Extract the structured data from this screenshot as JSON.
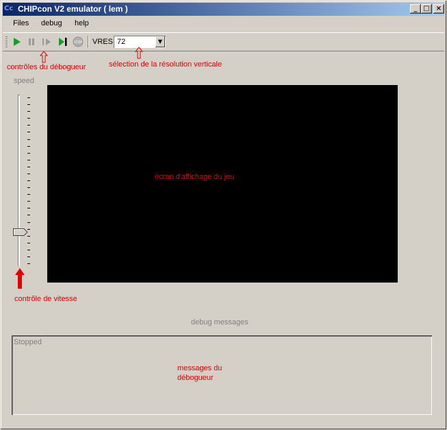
{
  "window": {
    "title": "CHIPcon V2 emulator ( lem )",
    "icon_glyph": "Cc",
    "controls": {
      "minimize": "_",
      "maximize": "□",
      "close": "×"
    }
  },
  "menu": {
    "items": [
      {
        "label": "Files"
      },
      {
        "label": "debug"
      },
      {
        "label": "help"
      }
    ]
  },
  "toolbar": {
    "buttons": [
      {
        "name": "run",
        "icon": "play-icon"
      },
      {
        "name": "pause",
        "icon": "pause-icon"
      },
      {
        "name": "step",
        "icon": "step-icon"
      },
      {
        "name": "step-over",
        "icon": "step-over-icon"
      },
      {
        "name": "stop",
        "icon": "stop-icon",
        "label": "STOP"
      }
    ],
    "vres_label": "VRES",
    "vres_value": "72"
  },
  "annotations": {
    "debugger_controls": "contrôles du débogueur",
    "vres_selection": "sélection de la résolution verticale",
    "speed_control": "contrôle de vitesse",
    "game_screen": "écran d'affichage du jeu",
    "debug_messages_note": "messages du débogueur"
  },
  "speed": {
    "label": "speed",
    "level": 0.2
  },
  "debug": {
    "label": "debug messages",
    "status": "Stopped"
  },
  "colors": {
    "annotation": "#e00000",
    "run_green": "#1a9a2a",
    "title_start": "#0a246a",
    "title_end": "#a6caf0",
    "screen": "#000000"
  }
}
